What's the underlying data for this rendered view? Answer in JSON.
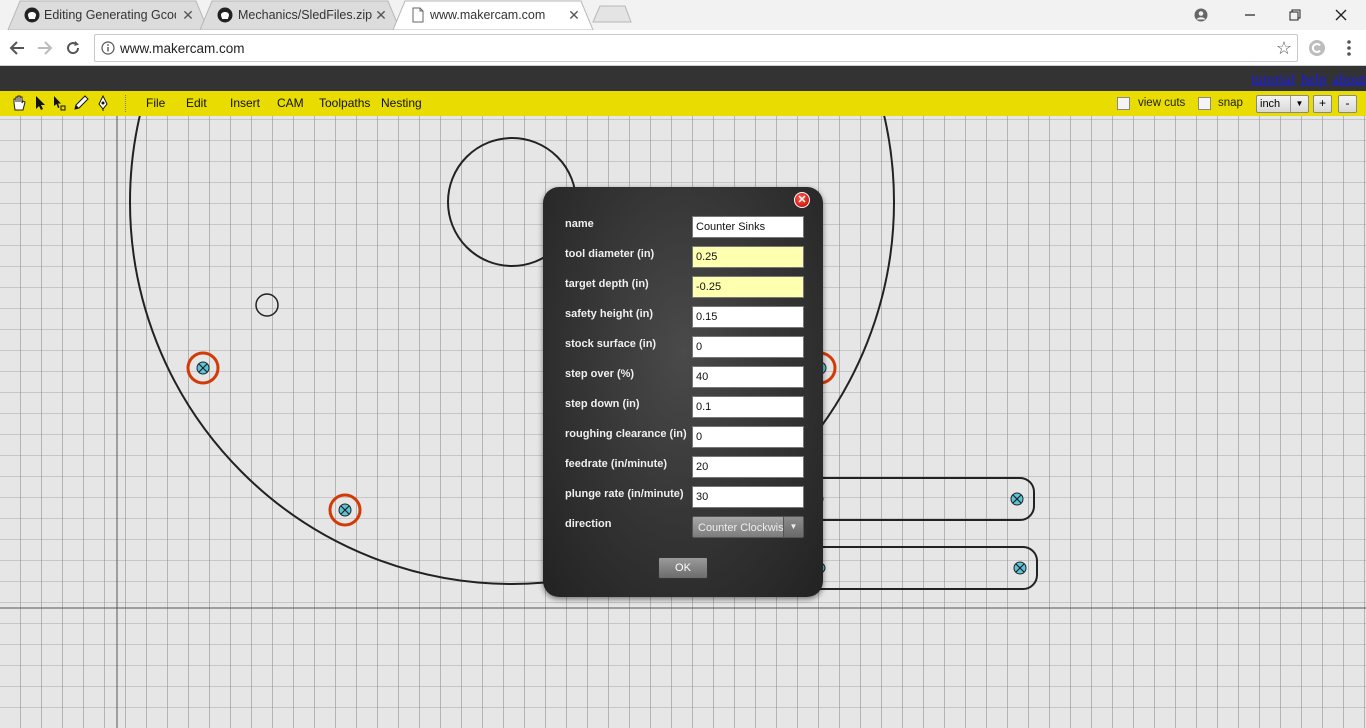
{
  "browser": {
    "tabs": [
      {
        "title": "Editing Generating Gcode",
        "favicon": "github-icon",
        "active": false
      },
      {
        "title": "Mechanics/SledFiles.zip a",
        "favicon": "github-icon",
        "active": false
      },
      {
        "title": "www.makercam.com",
        "favicon": "page-icon",
        "active": true
      }
    ],
    "url": "www.makercam.com"
  },
  "app": {
    "links": [
      "tutorial",
      "help",
      "about"
    ],
    "menu": [
      "File",
      "Edit",
      "Insert",
      "CAM",
      "Toolpaths",
      "Nesting"
    ],
    "tools": [
      "hand-tool-icon",
      "pointer-tool-icon",
      "node-tool-icon",
      "pen-tool-icon",
      "node-edit-tool-icon"
    ],
    "view_cuts_label": "view cuts",
    "snap_label": "snap",
    "unit": "inch",
    "zoom_in": "+",
    "zoom_out": "-"
  },
  "dialog": {
    "fields": [
      {
        "label": "name",
        "value": "Counter Sinks",
        "highlight": false
      },
      {
        "label": "tool diameter (in)",
        "value": "0.25",
        "highlight": true
      },
      {
        "label": "target depth (in)",
        "value": "-0.25",
        "highlight": true
      },
      {
        "label": "safety height (in)",
        "value": "0.15",
        "highlight": false
      },
      {
        "label": "stock surface (in)",
        "value": "0",
        "highlight": false
      },
      {
        "label": "step over (%)",
        "value": "40",
        "highlight": false
      },
      {
        "label": "step down (in)",
        "value": "0.1",
        "highlight": false
      },
      {
        "label": "roughing clearance (in)",
        "value": "0",
        "highlight": false
      },
      {
        "label": "feedrate (in/minute)",
        "value": "20",
        "highlight": false
      },
      {
        "label": "plunge rate (in/minute)",
        "value": "30",
        "highlight": false
      }
    ],
    "direction_label": "direction",
    "direction_value": "Counter Clockwise",
    "ok_label": "OK"
  }
}
